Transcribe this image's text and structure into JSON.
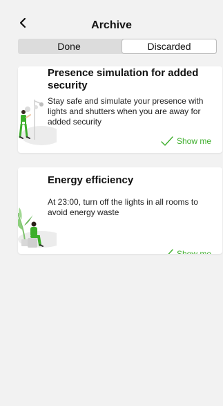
{
  "header": {
    "title": "Archive",
    "back_icon": "chevron-left-icon"
  },
  "tabs": {
    "done_label": "Done",
    "discarded_label": "Discarded",
    "selected": "Discarded"
  },
  "cards": [
    {
      "title": "Presence simulation for added security",
      "description": "Stay safe and simulate your presence with lights and shutters when you are away for added security",
      "action_label": "Show me",
      "action_icon": "checkmark-icon",
      "illustration_icon": "person-lamp-illustration"
    },
    {
      "title": "Energy efficiency",
      "description": "At 23:00, turn off the lights in all rooms to avoid energy waste",
      "action_label": "Show me",
      "action_icon": "checkmark-icon",
      "illustration_icon": "person-plant-illustration"
    }
  ],
  "colors": {
    "accent": "#3dae2b",
    "background": "#f2f2f2",
    "card": "#ffffff",
    "segment_bg": "#dcdcdc"
  }
}
